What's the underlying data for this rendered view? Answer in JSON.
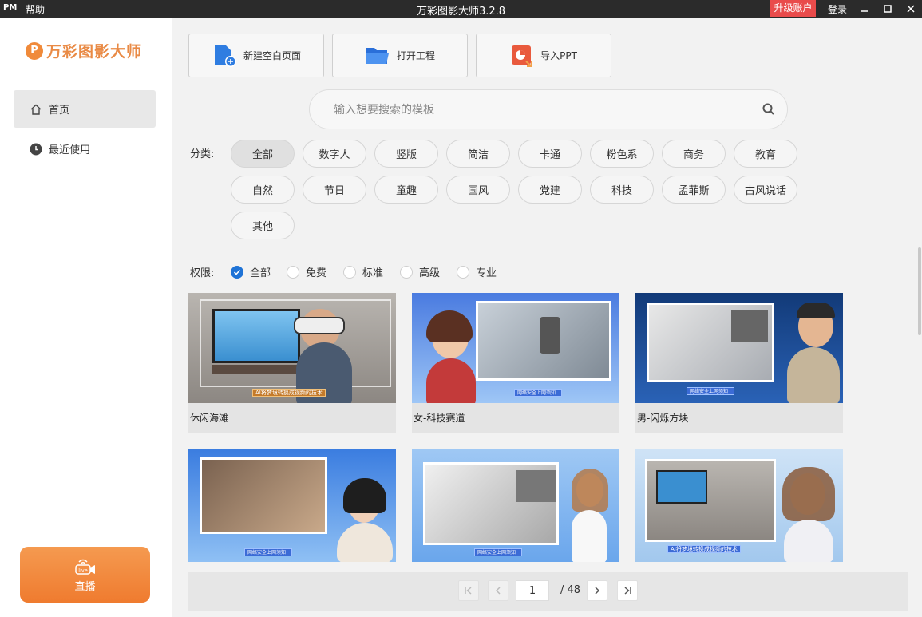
{
  "titlebar": {
    "pm": "PM",
    "help": "帮助",
    "title": "万彩图影大师3.2.8",
    "upgrade": "升级账户",
    "login": "登录"
  },
  "sidebar": {
    "logo_mark": "P",
    "logo_text": "万彩图影大师",
    "items": [
      {
        "label": "首页",
        "icon": "home-icon"
      },
      {
        "label": "最近使用",
        "icon": "clock-icon"
      }
    ],
    "live": {
      "badge": "live",
      "label": "直播"
    }
  },
  "actions": [
    {
      "label": "新建空白页面",
      "icon": "new-file-icon"
    },
    {
      "label": "打开工程",
      "icon": "folder-icon"
    },
    {
      "label": "导入PPT",
      "icon": "ppt-icon"
    }
  ],
  "search": {
    "placeholder": "输入想要搜索的模板"
  },
  "categories": {
    "label": "分类:",
    "items": [
      "全部",
      "数字人",
      "竖版",
      "简洁",
      "卡通",
      "粉色系",
      "商务",
      "教育",
      "自然",
      "节日",
      "童趣",
      "国风",
      "党建",
      "科技",
      "孟菲斯",
      "古风说话",
      "其他"
    ],
    "selected": "全部"
  },
  "permissions": {
    "label": "权限:",
    "options": [
      "全部",
      "免费",
      "标准",
      "高级",
      "专业"
    ],
    "selected": "全部"
  },
  "templates": [
    {
      "name": "休闲海滩",
      "banner": "AI将梦境转换成视频的技术"
    },
    {
      "name": "女-科技赛道",
      "banner": "网络安全上网须知"
    },
    {
      "name": "男-闪烁方块",
      "banner": "网络安全上网须知"
    },
    {
      "name": "",
      "banner": "网络安全上网须知"
    },
    {
      "name": "",
      "banner": "网络安全上网须知"
    },
    {
      "name": "",
      "banner": "AI将梦境转换成视频的技术"
    }
  ],
  "pager": {
    "current": "1",
    "total": "/ 48"
  },
  "colors": {
    "accent": "#1f73d6",
    "brand": "#ef7b2f",
    "upgrade": "#e94b4b"
  }
}
